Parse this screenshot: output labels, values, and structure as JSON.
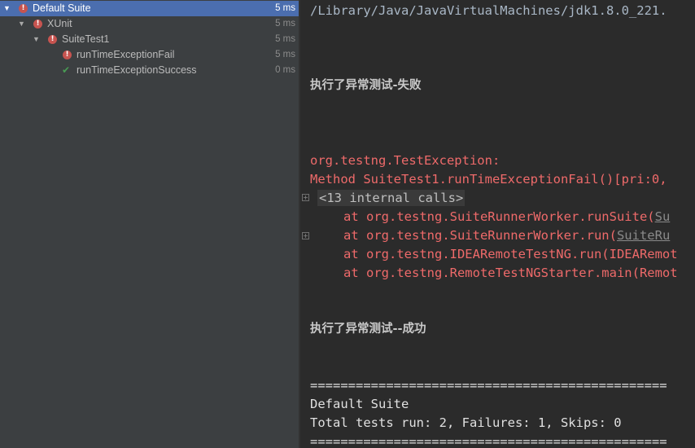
{
  "tree": {
    "rows": [
      {
        "label": "Default Suite",
        "time": "5 ms",
        "status": "fail"
      },
      {
        "label": "XUnit",
        "time": "5 ms",
        "status": "fail"
      },
      {
        "label": "SuiteTest1",
        "time": "5 ms",
        "status": "fail"
      },
      {
        "label": "runTimeExceptionFail",
        "time": "5 ms",
        "status": "fail"
      },
      {
        "label": "runTimeExceptionSuccess",
        "time": "0 ms",
        "status": "pass"
      }
    ]
  },
  "console": {
    "java_path": "/Library/Java/JavaVirtualMachines/jdk1.8.0_221.",
    "msg_fail": "执行了异常测试-失败",
    "exception": "org.testng.TestException:",
    "method_line": "Method SuiteTest1.runTimeExceptionFail()[pri:0,",
    "internal_calls": "<13 internal calls>",
    "stack": [
      {
        "text": "at org.testng.SuiteRunnerWorker.runSuite(",
        "link": "Su"
      },
      {
        "text": "at org.testng.SuiteRunnerWorker.run(",
        "link": "SuiteRu"
      },
      {
        "text": "at org.testng.IDEARemoteTestNG.run(IDEARemot",
        "link": ""
      },
      {
        "text": "at org.testng.RemoteTestNGStarter.main(Remot",
        "link": ""
      }
    ],
    "msg_success": "执行了异常测试--成功",
    "separator": "===============================================",
    "suite_name": "Default Suite",
    "summary": "Total tests run: 2, Failures: 1, Skips: 0"
  },
  "colors": {
    "fail": "#c75450",
    "pass": "#499c54",
    "selected": "#4b6eaf",
    "error_text": "#ee6a6a"
  }
}
